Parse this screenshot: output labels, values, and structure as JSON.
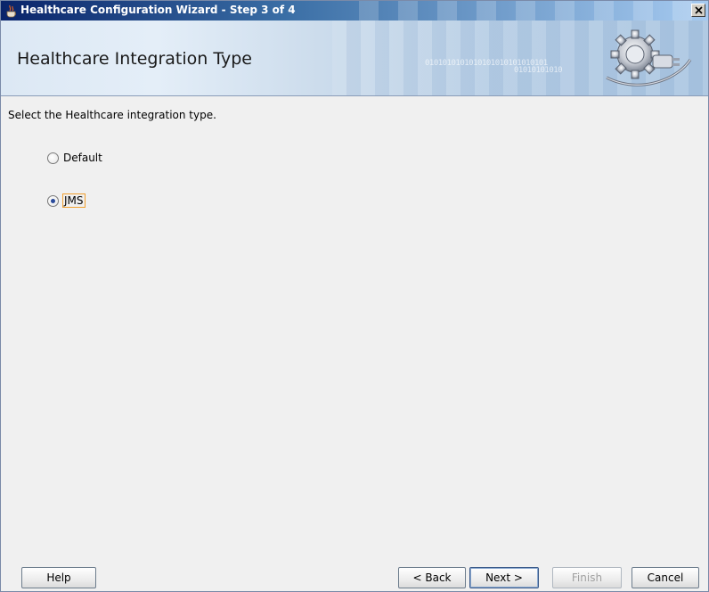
{
  "window": {
    "title": "Healthcare Configuration Wizard - Step 3 of 4"
  },
  "header": {
    "title": "Healthcare Integration Type",
    "binary_line1": "0101010101010101010101010101",
    "binary_line2": "01010101010"
  },
  "content": {
    "instruction": "Select the Healthcare integration type.",
    "options": [
      {
        "label": "Default",
        "selected": false
      },
      {
        "label": "JMS",
        "selected": true
      }
    ]
  },
  "buttons": {
    "help": "Help",
    "back": "< Back",
    "next": "Next >",
    "finish": "Finish",
    "cancel": "Cancel"
  },
  "icons": {
    "title": "java-cup-icon",
    "close": "close-icon",
    "header": "gear-plug-icon"
  }
}
